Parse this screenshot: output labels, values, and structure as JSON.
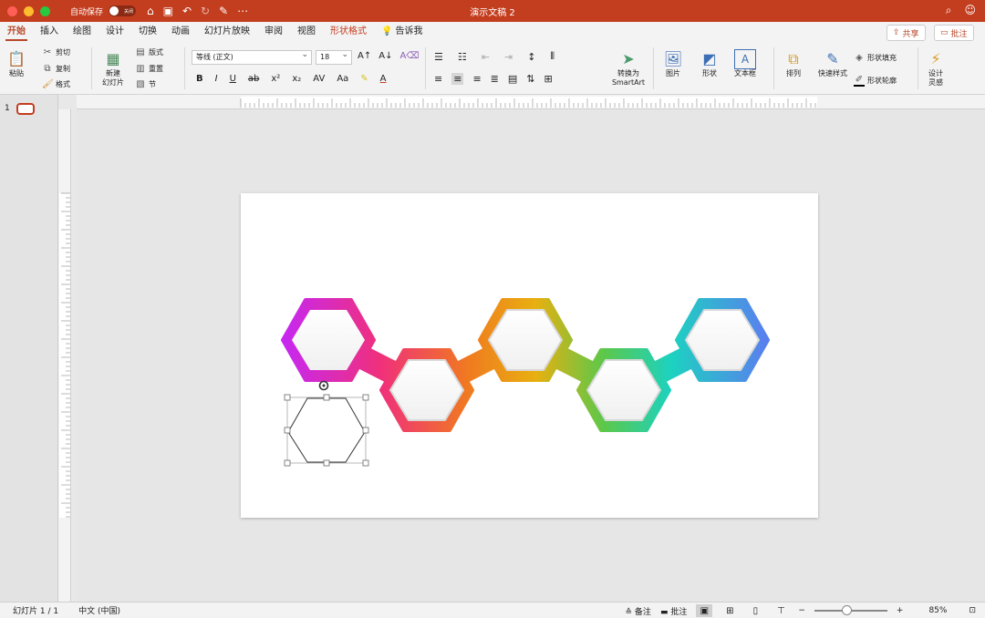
{
  "titlebar": {
    "autosave_label": "自动保存",
    "autosave_state": "关闭",
    "title": "演示文稿 2"
  },
  "tabs": [
    {
      "label": "开始",
      "active": true
    },
    {
      "label": "插入"
    },
    {
      "label": "绘图"
    },
    {
      "label": "设计"
    },
    {
      "label": "切换"
    },
    {
      "label": "动画"
    },
    {
      "label": "幻灯片放映"
    },
    {
      "label": "审阅"
    },
    {
      "label": "视图"
    },
    {
      "label": "形状格式"
    }
  ],
  "tell_me": "告诉我",
  "share": "共享",
  "comments_btn": "批注",
  "ribbon": {
    "paste": "粘贴",
    "cut": "剪切",
    "copy": "复制",
    "format_painter": "格式",
    "new_slide": "新建\n幻灯片",
    "layout": "版式",
    "reset": "重置",
    "section": "节",
    "font_name": "等线 (正文)",
    "font_size": "18",
    "convert_smartart": "转换为\nSmartArt",
    "picture": "图片",
    "shapes": "形状",
    "textbox": "文本框",
    "arrange": "排列",
    "quick_styles": "快速样式",
    "shape_fill": "形状填充",
    "shape_outline": "形状轮廓",
    "design_ideas": "设计\n灵感"
  },
  "slide_panel": {
    "number": "1"
  },
  "status": {
    "slide_count": "幻灯片 1 / 1",
    "language": "中文 (中国)",
    "notes": "备注",
    "comments": "批注",
    "zoom": "85%"
  },
  "colors": {
    "accent": "#c33d1f",
    "hex_gradient": [
      "#c728f0",
      "#f0307a",
      "#f07a20",
      "#e8b010",
      "#5cc84a",
      "#1cd2c0",
      "#3a9ef0",
      "#5a7ef0"
    ]
  }
}
